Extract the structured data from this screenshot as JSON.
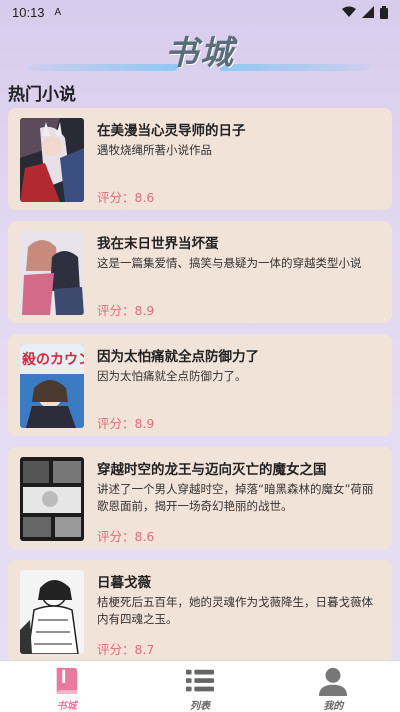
{
  "status_bar": {
    "time": "10:13",
    "notification": "A"
  },
  "header": {
    "title": "书城"
  },
  "section": {
    "title": "热门小说"
  },
  "books": [
    {
      "title": "在美漫当心灵导师的日子",
      "desc": "遇牧烧绳所著小说作品",
      "score": "评分：8.6"
    },
    {
      "title": "我在末日世界当坏蛋",
      "desc": "这是一篇集爱情、搞笑与悬疑为一体的穿越类型小说",
      "score": "评分：8.9"
    },
    {
      "title": "因为太怕痛就全点防御力了",
      "desc": "因为太怕痛就全点防御力了。",
      "score": "评分：8.9"
    },
    {
      "title": "穿越时空的龙王与迈向灭亡的魔女之国",
      "desc": "讲述了一个男人穿越时空，掉落“暗黑森林的魔女”荷丽歌恩面前，揭开一场奇幻艳丽的战世。",
      "score": "评分：8.6"
    },
    {
      "title": "日暮戈薇",
      "desc": "桔梗死后五百年，她的灵魂作为戈薇降生，日暮戈薇体内有四魂之玉。",
      "score": "评分：8.7"
    }
  ],
  "cover_text": {
    "book3": "殺のカウンス"
  },
  "tabs": [
    {
      "label": "书城",
      "icon": "book-icon",
      "active": true
    },
    {
      "label": "列表",
      "icon": "list-icon",
      "active": false
    },
    {
      "label": "我的",
      "icon": "user-icon",
      "active": false
    }
  ],
  "colors": {
    "accent": "#e87a9f",
    "score": "#e06c7a",
    "card": "#f2e3d9"
  }
}
